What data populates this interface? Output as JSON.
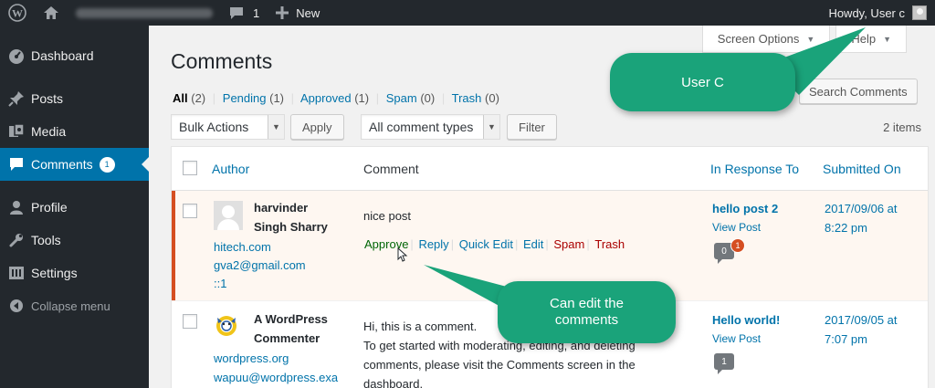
{
  "adminbar": {
    "count": "1",
    "new_label": "New",
    "howdy": "Howdy, User c"
  },
  "sidebar": {
    "items": [
      {
        "label": "Dashboard",
        "icon": "dashboard-icon"
      },
      {
        "label": "Posts",
        "icon": "pin-icon"
      },
      {
        "label": "Media",
        "icon": "media-icon"
      },
      {
        "label": "Comments",
        "icon": "comment-icon",
        "badge": "1"
      },
      {
        "label": "Profile",
        "icon": "user-icon"
      },
      {
        "label": "Tools",
        "icon": "wrench-icon"
      },
      {
        "label": "Settings",
        "icon": "settings-icon"
      },
      {
        "label": "Collapse menu",
        "icon": "collapse-icon"
      }
    ]
  },
  "screen_tabs": {
    "options": "Screen Options",
    "help": "Help"
  },
  "page": {
    "title": "Comments"
  },
  "filters": {
    "all": {
      "label": "All",
      "count": "(2)"
    },
    "pending": {
      "label": "Pending",
      "count": "(1)"
    },
    "approved": {
      "label": "Approved",
      "count": "(1)"
    },
    "spam": {
      "label": "Spam",
      "count": "(0)"
    },
    "trash": {
      "label": "Trash",
      "count": "(0)"
    },
    "sep": "|"
  },
  "search": {
    "button": "Search Comments"
  },
  "tablenav": {
    "bulk_actions": "Bulk Actions",
    "apply": "Apply",
    "comment_types": "All comment types",
    "filter": "Filter",
    "items": "2 items"
  },
  "columns": {
    "author": "Author",
    "comment": "Comment",
    "response": "In Response To",
    "submitted": "Submitted On"
  },
  "rows": [
    {
      "author_name_1": "harvinder",
      "author_name_2": "Singh Sharry",
      "url": "hitech.com",
      "email": "gva2@gmail.com",
      "ip": "::1",
      "comment": "nice post",
      "actions": {
        "approve": "Approve",
        "reply": "Reply",
        "quick_edit": "Quick Edit",
        "edit": "Edit",
        "spam": "Spam",
        "trash": "Trash"
      },
      "post_title": "hello post 2",
      "view_post": "View Post",
      "approved_count": "0",
      "pending_count": "1",
      "date_1": "2017/09/06 at",
      "date_2": "8:22 pm"
    },
    {
      "author_name_1": "A WordPress",
      "author_name_2": "Commenter",
      "url": "wordpress.org",
      "email": "wapuu@wordpress.exa",
      "comment_1": "Hi, this is a comment.",
      "comment_2": "To get started with moderating, editing, and deleting",
      "comment_3": "comments, please visit the Comments screen in the",
      "comment_4": "dashboard.",
      "post_title": "Hello world!",
      "view_post": "View Post",
      "approved_count": "1",
      "date_1": "2017/09/05 at",
      "date_2": "7:07 pm"
    }
  ],
  "callouts": {
    "user": "User C",
    "edit_1": "Can edit the",
    "edit_2": "comments"
  },
  "colors": {
    "accent": "#0073aa",
    "pending_border": "#d54e21",
    "callout": "#1aa37a"
  }
}
